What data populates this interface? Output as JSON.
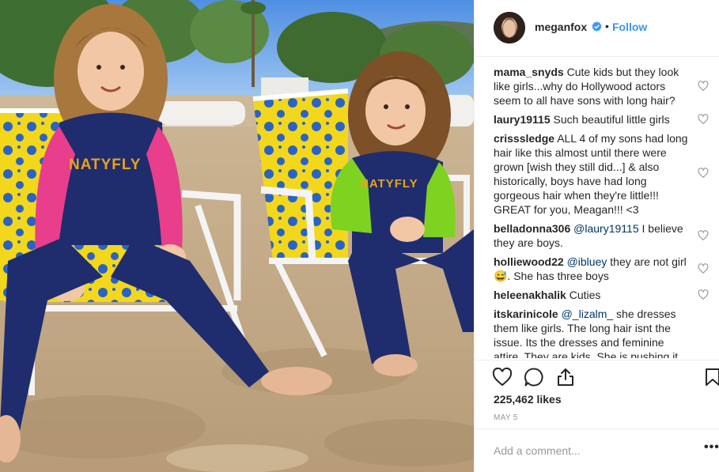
{
  "post": {
    "username": "meganfox",
    "dot": "•",
    "follow_label": "Follow",
    "likes": "225,462 likes",
    "date": "MAY 5",
    "shirt_brand": "NATYFLY",
    "add_comment_placeholder": "Add a comment...",
    "more_label": "•••"
  },
  "colors": {
    "accent": "#3897f0",
    "mention": "#003569",
    "muted": "#999999"
  },
  "icons": {
    "verified": "verified-badge-icon",
    "like": "heart-outline-icon",
    "comment": "speech-bubble-icon",
    "share": "share-upload-icon",
    "save": "bookmark-icon",
    "comment_like": "small-heart-icon"
  },
  "comments": [
    {
      "user": "mama_snyds",
      "text": "Cute kids but they look like girls...why do Hollywood actors seem to all have sons with long hair?"
    },
    {
      "user": "laury19115",
      "text": "Such beautiful little girls"
    },
    {
      "user": "crisssledge",
      "text": "ALL 4 of my sons had long hair like this almost until there were grown [wish they still did...] & also historically, boys have had long gorgeous hair when they're little!!! GREAT for you, Meagan!!! <3"
    },
    {
      "user": "belladonna306",
      "mention": "@laury19115",
      "text": " I believe they are boys."
    },
    {
      "user": "holliewood22",
      "mention": "@ibluey",
      "text": " they are not girl 😅. She has three boys"
    },
    {
      "user": "heleenakhalik",
      "text": "Cuties"
    },
    {
      "user": "itskarinicole",
      "mention": "@_lizalm_",
      "text": " she dresses them like girls. The long hair isnt the issue. Its the dresses and feminine attire. They are kids. She is pushing it"
    }
  ]
}
